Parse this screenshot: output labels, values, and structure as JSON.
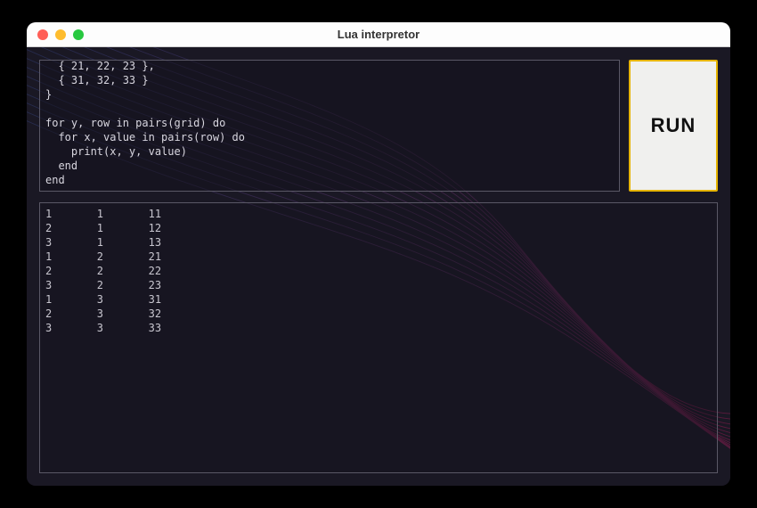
{
  "window": {
    "title": "Lua interpretor"
  },
  "editor": {
    "code": "  { 21, 22, 23 },\n  { 31, 32, 33 }\n}\n\nfor y, row in pairs(grid) do\n  for x, value in pairs(row) do\n    print(x, y, value)\n  end\nend"
  },
  "run": {
    "label": "RUN"
  },
  "output": {
    "text": "1\t1\t11\n2\t1\t12\n3\t1\t13\n1\t2\t21\n2\t2\t22\n3\t2\t23\n1\t3\t31\n2\t3\t32\n3\t3\t33"
  },
  "colors": {
    "accent": "#e6b400",
    "bg": "#1a1824"
  }
}
